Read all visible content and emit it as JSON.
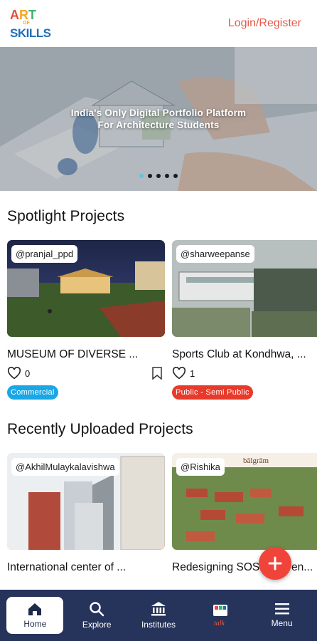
{
  "header": {
    "logo_art": "ART",
    "logo_of": "OF",
    "logo_skills": "SKILLS",
    "login_label": "Login/Register"
  },
  "hero": {
    "title_line1": "India's Only Digital Portfolio Platform",
    "title_line2": "For Architecture Students",
    "slide_count": 5,
    "active_slide": 1
  },
  "spotlight": {
    "title": "Spotlight Projects",
    "cards": [
      {
        "handle": "@pranjal_ppd",
        "title": "MUSEUM OF DIVERSE ...",
        "likes": "0",
        "tag": "Commercial",
        "tag_color": "#19a7e6"
      },
      {
        "handle": "@sharweepanse",
        "title": "Sports Club at Kondhwa, ...",
        "likes": "1",
        "tag": "Public - Semi Public",
        "tag_color": "#e83a2a"
      }
    ]
  },
  "recent": {
    "title": "Recently Uploaded Projects",
    "cards": [
      {
        "handle": "@AkhilMulaykalavishwa",
        "title": "International center of ..."
      },
      {
        "handle": "@Rishika",
        "title": "Redesigning SOS Children..."
      }
    ]
  },
  "fab": {
    "icon": "plus-icon"
  },
  "nav": {
    "items": [
      {
        "label": "Home",
        "icon": "home-icon",
        "active": true
      },
      {
        "label": "Explore",
        "icon": "search-icon",
        "active": false
      },
      {
        "label": "Institutes",
        "icon": "institute-icon",
        "active": false
      },
      {
        "label": "Talk",
        "icon": "talk-icon",
        "active": false
      },
      {
        "label": "Menu",
        "icon": "menu-icon",
        "active": false
      }
    ]
  },
  "colors": {
    "accent": "#e45a4b",
    "nav_bg": "#26335a",
    "fab": "#f0443a"
  }
}
